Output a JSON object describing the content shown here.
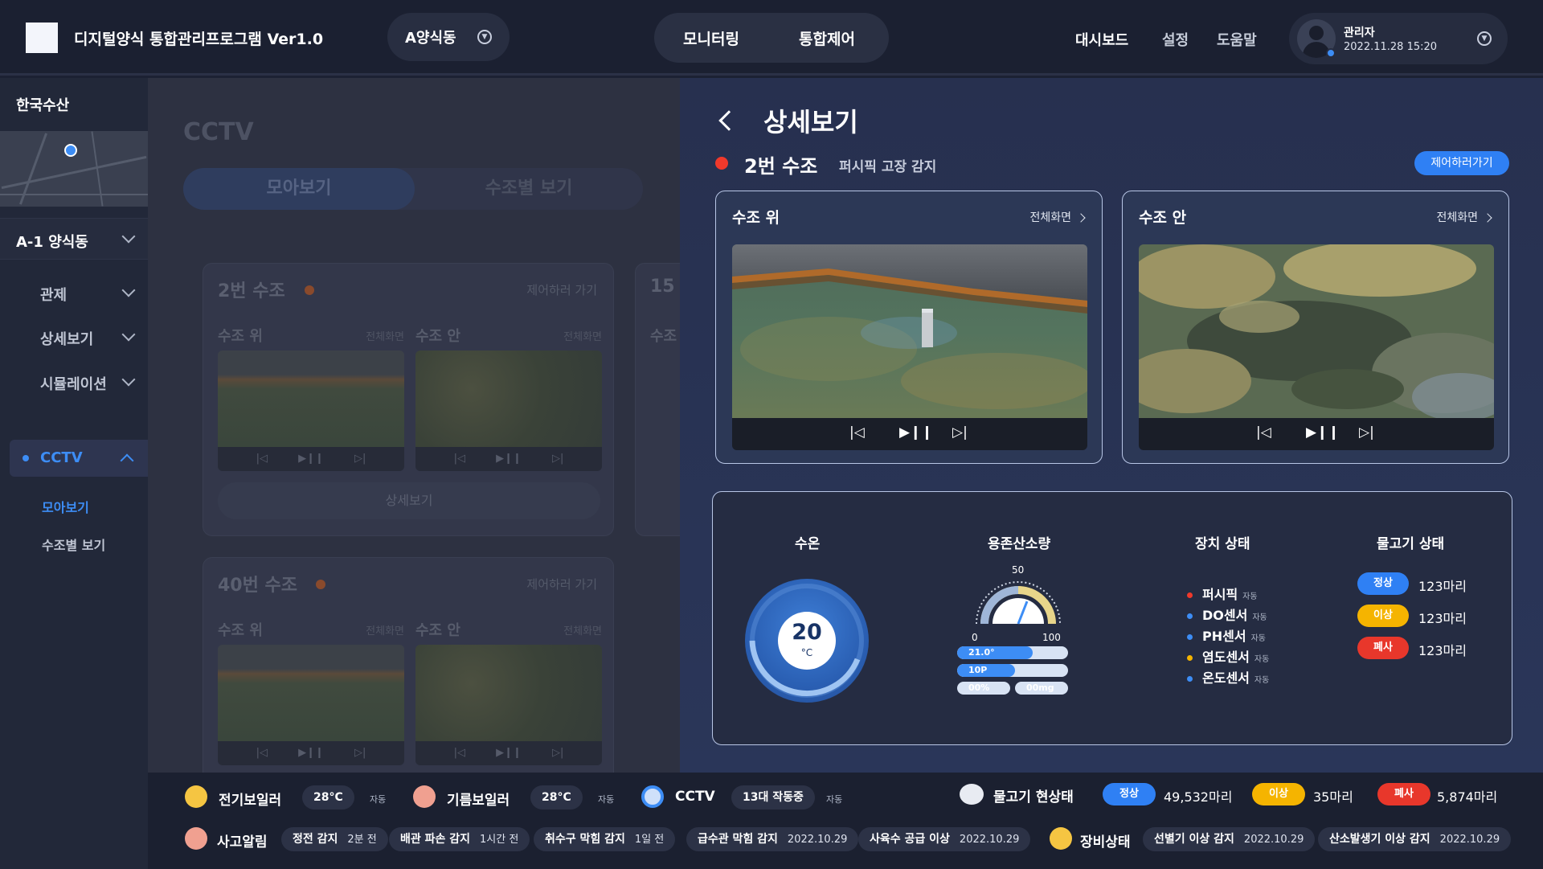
{
  "header": {
    "title": "디지털양식 통합관리프로그램 Ver1.0",
    "farm_select": "A양식동",
    "mode_tabs": [
      "모니터링",
      "통합제어"
    ],
    "links": [
      "대시보드",
      "설정",
      "도움말"
    ],
    "user": {
      "name": "관리자",
      "datetime": "2022.11.28 15:20"
    }
  },
  "sidebar": {
    "company": "한국수산",
    "section": "A-1 양식동",
    "items": [
      "관제",
      "상세보기",
      "시뮬레이션"
    ],
    "active_item": "CCTV",
    "sub_items": [
      "모아보기",
      "수조별 보기"
    ]
  },
  "background": {
    "title": "CCTV",
    "tabs": [
      "모아보기",
      "수조별 보기"
    ],
    "cards": [
      {
        "title": "2번 수조",
        "control": "제어하러 가기",
        "detail_btn": "상세보기"
      },
      {
        "title": "40번 수조",
        "control": "제어하러 가기"
      }
    ],
    "cam_labels": [
      "수조 위",
      "수조 안"
    ],
    "fullscreen": "전체화면",
    "partial_card_title": "15",
    "partial_cam_label": "수조"
  },
  "detail": {
    "title": "상세보기",
    "tank": "2번 수조",
    "alert": "퍼시픽 고장 감지",
    "control_button": "제어하러가기",
    "cameras": [
      {
        "label": "수조 위",
        "fullscreen": "전체화면"
      },
      {
        "label": "수조 안",
        "fullscreen": "전체화면"
      }
    ],
    "player": {
      "prev": "|◁",
      "play": "▶❙❙",
      "next": "▷|"
    },
    "status": {
      "headers": [
        "수온",
        "용존산소량",
        "장치 상태",
        "물고기 상태"
      ],
      "temperature": {
        "value": "20",
        "unit": "°C"
      },
      "oxygen": {
        "gauge_min": "0",
        "gauge_mid": "50",
        "gauge_max": "100",
        "gauge_level": 0.62,
        "bars": [
          {
            "label": "21.0°",
            "fill": 0.68
          },
          {
            "label": "10P",
            "fill": 0.52
          },
          {
            "label": "00%",
            "fill": 0.0
          },
          {
            "label": "00mg",
            "fill": 0.0
          }
        ]
      },
      "devices": [
        {
          "name": "퍼시픽",
          "mode": "자동",
          "color": "#f0392b"
        },
        {
          "name": "DO센서",
          "mode": "자동",
          "color": "#3d8df5"
        },
        {
          "name": "PH센서",
          "mode": "자동",
          "color": "#3d8df5"
        },
        {
          "name": "염도센서",
          "mode": "자동",
          "color": "#f5b400"
        },
        {
          "name": "온도센서",
          "mode": "자동",
          "color": "#3d8df5"
        }
      ],
      "fish": [
        {
          "status": "정상",
          "count": "123마리",
          "color": "#2f80f4",
          "text_color": "#ffffff"
        },
        {
          "status": "이상",
          "count": "123마리",
          "color": "#f5b400",
          "text_color": "#ffffff"
        },
        {
          "status": "폐사",
          "count": "123마리",
          "color": "#e8372b",
          "text_color": "#ffffff"
        }
      ]
    }
  },
  "bottom": {
    "equip": [
      {
        "label": "전기보일러",
        "value": "28°C",
        "mode": "자동"
      },
      {
        "label": "기름보일러",
        "value": "28°C",
        "mode": "자동"
      },
      {
        "label": "CCTV",
        "value": "13대 작동중",
        "mode": "자동"
      }
    ],
    "fish_status": {
      "label": "물고기 현상태",
      "items": [
        {
          "status": "정상",
          "count": "49,532마리"
        },
        {
          "status": "이상",
          "count": "35마리"
        },
        {
          "status": "폐사",
          "count": "5,874마리"
        }
      ]
    },
    "alarm": {
      "label": "사고알림",
      "items": [
        {
          "text": "정전 감지",
          "time": "2분 전"
        },
        {
          "text": "배관 파손 감지",
          "time": "1시간 전"
        },
        {
          "text": "취수구 막힘 감지",
          "time": "1일 전"
        },
        {
          "text": "급수관 막힘 감지",
          "time": "2022.10.29"
        },
        {
          "text": "사육수 공급 이상",
          "time": "2022.10.29"
        }
      ]
    },
    "equip_status": {
      "label": "장비상태",
      "items": [
        {
          "text": "선별기 이상 감지",
          "time": "2022.10.29"
        },
        {
          "text": "산소발생기 이상 감지",
          "time": "2022.10.29"
        }
      ]
    }
  },
  "colors": {
    "accent": "#3d8df5",
    "alert": "#f0392b",
    "warning": "#f5b400"
  }
}
